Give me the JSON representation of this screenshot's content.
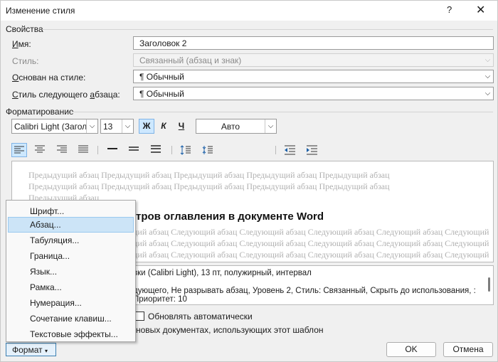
{
  "window": {
    "title": "Изменение стиля",
    "help": "?",
    "close": "✕"
  },
  "properties": {
    "group_label": "Свойства",
    "name_label": "Имя:",
    "name_value": "Заголовок 2",
    "style_label": "Стиль:",
    "style_value": "Связанный (абзац и знак)",
    "based_on_label": "Основан на стиле:",
    "based_on_value": "¶  Обычный",
    "next_label": "Стиль следующего абзаца:",
    "next_value": "¶  Обычный"
  },
  "formatting": {
    "group_label": "Форматирование",
    "font": "Calibri Light (Заголо",
    "size": "13",
    "bold": "Ж",
    "italic": "К",
    "underline": "Ч",
    "color": "Авто"
  },
  "preview": {
    "prev_line1": "Предыдущий абзац Предыдущий абзац Предыдущий абзац Предыдущий абзац Предыдущий абзац",
    "prev_line2": "Предыдущий абзац Предыдущий абзац Предыдущий абзац Предыдущий абзац Предыдущий абзац",
    "prev_line3": "Предыдущий абзац",
    "heading": "тров оглавления в документе Word",
    "next_line1": "ций абзац Следующий абзац Следующий абзац Следующий абзац Следующий абзац Следующий",
    "next_line2": "ций абзац Следующий абзац Следующий абзац Следующий абзац Следующий абзац Следующий",
    "next_line3": "ций абзац Следующий абзац Следующий абзац Следующий абзац Следующий абзац Следующий"
  },
  "description": {
    "line1": "вки (Calibri Light), 13 пт, полужирный, интервал",
    "line2": "дующего, Не разрывать абзац, Уровень 2, Стиль: Связанный, Скрыть до использования, :",
    "line3": "Приоритет: 10"
  },
  "options": {
    "auto_update_label": "Обновлять автоматически",
    "new_docs_label": "новых документах, использующих этот шаблон"
  },
  "menu": {
    "items": [
      {
        "label": "Шрифт..."
      },
      {
        "label": "Абзац..."
      },
      {
        "label": "Табуляция..."
      },
      {
        "label": "Граница..."
      },
      {
        "label": "Язык..."
      },
      {
        "label": "Рамка..."
      },
      {
        "label": "Нумерация..."
      },
      {
        "label": "Сочетание клавиш..."
      },
      {
        "label": "Текстовые эффекты..."
      }
    ]
  },
  "buttons": {
    "format": "Формат",
    "ok": "OK",
    "cancel": "Отмена"
  },
  "colors": {
    "accent": "#0078d4",
    "hover": "#cce4f7",
    "active_button": "#cde8ff"
  }
}
